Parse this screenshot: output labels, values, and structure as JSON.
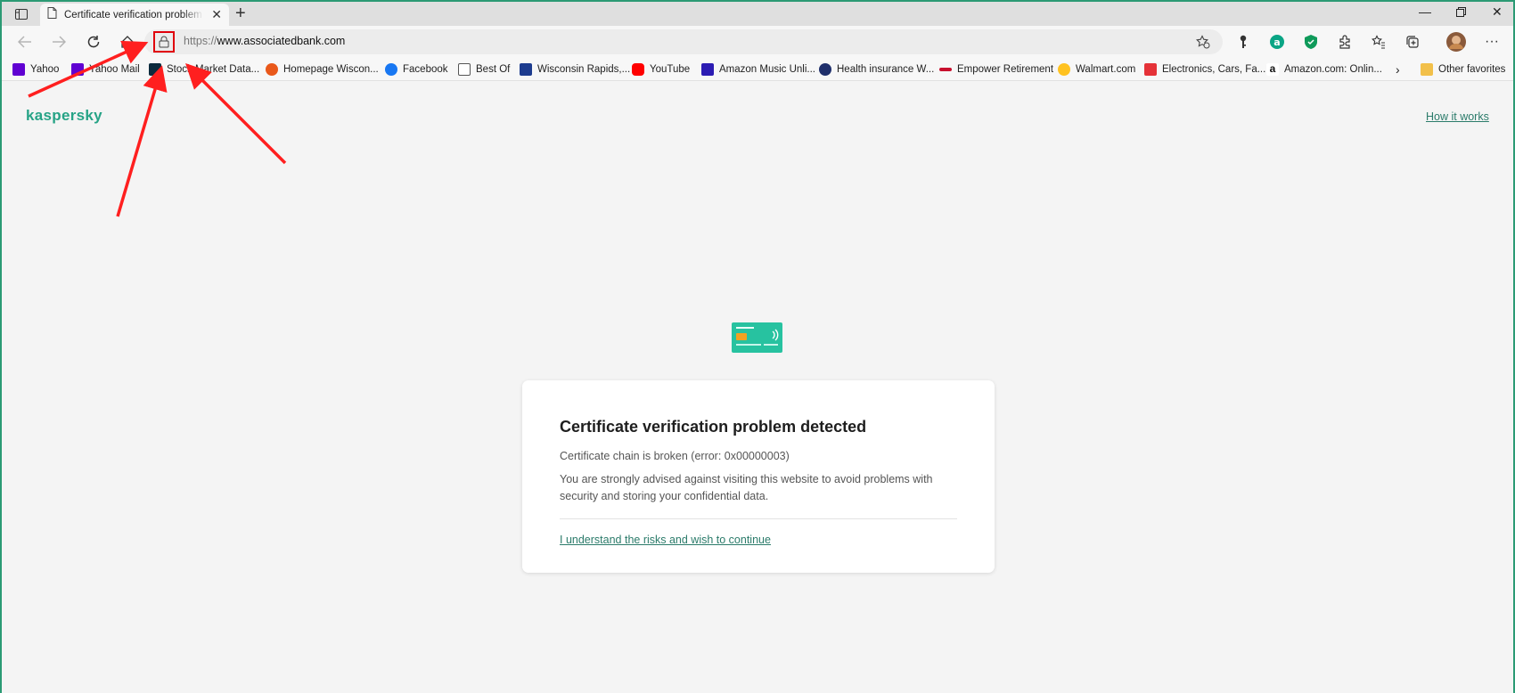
{
  "browser": {
    "tab_title": "Certificate verification problem detected",
    "url_protocol": "https://",
    "url_host": "www.associatedbank.com"
  },
  "favorites": [
    {
      "label": "Yahoo",
      "color": "#6001d2"
    },
    {
      "label": "Yahoo Mail",
      "color": "#6001d2"
    },
    {
      "label": "Stock Market Data...",
      "color": "#0b2a3d"
    },
    {
      "label": "Homepage  Wiscon...",
      "color": "#e9581a"
    },
    {
      "label": "Facebook",
      "color": "#1877f2"
    },
    {
      "label": "Best Of",
      "color": "#ffffff"
    },
    {
      "label": "Wisconsin Rapids,...",
      "color": "#1d3c8f"
    },
    {
      "label": "YouTube",
      "color": "#ff0000"
    },
    {
      "label": "Amazon Music Unli...",
      "color": "#2c1cb3"
    },
    {
      "label": "Health insurance W...",
      "color": "#1f2f6b"
    },
    {
      "label": "Empower Retirement",
      "color": "#c8102e"
    },
    {
      "label": "Walmart.com",
      "color": "#ffc220"
    },
    {
      "label": "Electronics, Cars, Fa...",
      "color": "#e53238"
    },
    {
      "label": "Amazon.com: Onlin...",
      "color": "#111111"
    }
  ],
  "other_favorites": "Other favorites",
  "page": {
    "logo": "kaspersky",
    "how_it_works": "How it works",
    "title": "Certificate verification problem detected",
    "error_line": "Certificate chain is broken (error: 0x00000003)",
    "advice": "You are strongly advised against visiting this website to avoid problems with security and storing your confidential data.",
    "continue_link": "I understand the risks and wish to continue"
  },
  "colors": {
    "accent": "#26a386",
    "link": "#2b7b6a",
    "annotation": "#e0000b"
  }
}
